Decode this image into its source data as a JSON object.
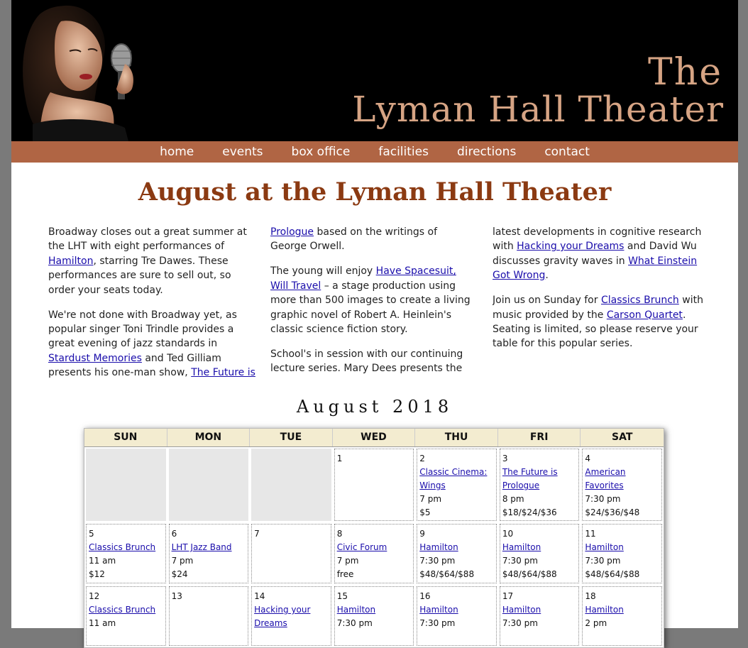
{
  "header": {
    "title_line1": "The",
    "title_line2": "Lyman Hall Theater"
  },
  "nav": {
    "items": [
      "home",
      "events",
      "box office",
      "facilities",
      "directions",
      "contact"
    ]
  },
  "page_title": "August at the Lyman Hall Theater",
  "intro": {
    "col1": {
      "p1_a": "Broadway closes out a great summer at the LHT with eight performances of ",
      "p1_link": "Hamilton",
      "p1_b": ", starring Tre Dawes. These performances are sure to sell out, so order your seats today.",
      "p2_a": "We're not done with Broadway yet, as popular singer Toni Trindle provides a great evening of jazz standards in ",
      "p2_link1": "Stardust Memories",
      "p2_b": " and Ted Gilliam presents his one-man show, ",
      "p2_link2": "The Future is"
    },
    "col2": {
      "p1_link": "Prologue",
      "p1_b": " based on the writings of George Orwell.",
      "p2_a": "The young will enjoy ",
      "p2_link": "Have Spacesuit, Will Travel",
      "p2_b": " – a stage production using more than 500 images to create a living graphic novel of Robert A. Heinlein's classic science fiction story.",
      "p3": "School's in session with our continuing lecture series. Mary Dees presents the"
    },
    "col3": {
      "p1_a": "latest developments in cognitive research with ",
      "p1_link1": "Hacking your Dreams",
      "p1_b": " and David Wu discusses gravity waves in ",
      "p1_link2": "What Einstein Got Wrong",
      "p1_c": ".",
      "p2_a": "Join us on Sunday for ",
      "p2_link1": "Classics Brunch",
      "p2_b": " with music provided by the ",
      "p2_link2": "Carson Quartet",
      "p2_c": ". Seating is limited, so please reserve your table for this popular series."
    }
  },
  "calendar": {
    "heading": "August 2018",
    "days_of_week": [
      "SUN",
      "MON",
      "TUE",
      "WED",
      "THU",
      "FRI",
      "SAT"
    ],
    "weeks": [
      [
        {
          "empty": true
        },
        {
          "empty": true
        },
        {
          "empty": true
        },
        {
          "day": "1"
        },
        {
          "day": "2",
          "event": "Classic Cinema: Wings",
          "time": "7 pm",
          "price": "$5"
        },
        {
          "day": "3",
          "event": "The Future is Prologue",
          "time": "8 pm",
          "price": "$18/$24/$36"
        },
        {
          "day": "4",
          "event": "American Favorites",
          "time": "7:30 pm",
          "price": "$24/$36/$48"
        }
      ],
      [
        {
          "day": "5",
          "event": "Classics Brunch",
          "time": "11 am",
          "price": "$12"
        },
        {
          "day": "6",
          "event": "LHT Jazz Band",
          "time": "7 pm",
          "price": "$24"
        },
        {
          "day": "7"
        },
        {
          "day": "8",
          "event": "Civic Forum",
          "time": "7 pm",
          "price": "free"
        },
        {
          "day": "9",
          "event": "Hamilton",
          "time": "7:30 pm",
          "price": "$48/$64/$88"
        },
        {
          "day": "10",
          "event": "Hamilton",
          "time": "7:30 pm",
          "price": "$48/$64/$88"
        },
        {
          "day": "11",
          "event": "Hamilton",
          "time": "7:30 pm",
          "price": "$48/$64/$88"
        }
      ],
      [
        {
          "day": "12",
          "event": "Classics Brunch",
          "time": "11 am"
        },
        {
          "day": "13"
        },
        {
          "day": "14",
          "event": "Hacking your Dreams"
        },
        {
          "day": "15",
          "event": "Hamilton",
          "time": "7:30 pm"
        },
        {
          "day": "16",
          "event": "Hamilton",
          "time": "7:30 pm"
        },
        {
          "day": "17",
          "event": "Hamilton",
          "time": "7:30 pm"
        },
        {
          "day": "18",
          "event": "Hamilton",
          "time": "2 pm"
        }
      ]
    ]
  },
  "colors": {
    "nav_bg": "#b06544",
    "title_color": "#8b3a12",
    "masthead_text": "#d6a484",
    "link": "#1a0dab"
  }
}
